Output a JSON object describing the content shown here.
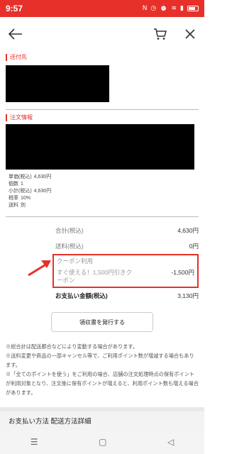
{
  "status_bar": {
    "time": "9:57",
    "icons": [
      "notification-icon",
      "clock-icon",
      "alarm-icon",
      "wifi-icon",
      "signal-icon",
      "battery-icon"
    ]
  },
  "app_bar": {
    "back_icon": "back-arrow-icon",
    "cart_icon": "cart-icon",
    "close_icon": "close-icon"
  },
  "shipping": {
    "label": "送付先"
  },
  "order": {
    "label": "注文情報",
    "details": [
      {
        "label": "単価(税込)",
        "value": "4,630円"
      },
      {
        "label": "個数",
        "value": "1"
      },
      {
        "label": "小計(税込)",
        "value": "4,630円"
      },
      {
        "label": "税率",
        "value": "10%"
      },
      {
        "label": "送料",
        "value": "別"
      }
    ]
  },
  "summary": {
    "total_label": "合計(税込)",
    "total_value": "4,630円",
    "shipping_label": "送料(税込)",
    "shipping_value": "0円",
    "coupon_title": "クーポン利用",
    "coupon_name_line1": "すぐ使える！1,500円引きク",
    "coupon_name_line2": "ーポン",
    "coupon_value": "-1,500円",
    "payment_label": "お支払い金額(税込)",
    "payment_value": "3,130円"
  },
  "receipt_button": "領収書を発行する",
  "notes": [
    "※総合計は配送都合などにより変動する場合があります。",
    "※送料変更や商品の一部キャンセル等で、ご利用ポイント数が増減する場合もあります。",
    "※「全てのポイントを使う」をご利用の場合、店舗の注文処理時点の保有ポイントが利用対象となり、注文後に保有ポイントが増えると、利用ポイント数も増える場合があります。"
  ],
  "payment_section": "お支払い方法 配送方法詳細",
  "colors": {
    "accent": "#e8302a"
  }
}
